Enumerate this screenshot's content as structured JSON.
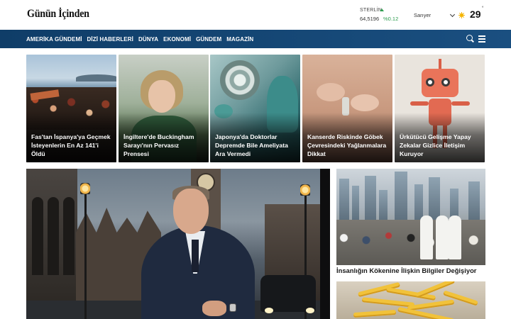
{
  "header": {
    "logo_text": "Günün İçinden",
    "currency": {
      "name": "STERLİN",
      "trend": "up",
      "value": "64,5196",
      "change": "%0.12",
      "trend_color": "#2e9e4f"
    },
    "weather": {
      "city": "Sarıyer",
      "temperature": "29",
      "unit": "°",
      "icon": "sun-icon"
    }
  },
  "nav": {
    "items": [
      "AMERİKA GÜNDEMİ",
      "DİZİ HABERLERİ",
      "DÜNYA",
      "EKONOMİ",
      "GÜNDEM",
      "MAGAZİN"
    ],
    "background": "#0f3d68",
    "icons": [
      "search-icon",
      "menu-icon"
    ]
  },
  "cards": [
    {
      "title": "Fas'tan İspanya'ya Geçmek İsteyenlerin En Az 141'i Öldü"
    },
    {
      "title": "İngiltere'de Buckingham Sarayı'nın Pervasız Prensesi"
    },
    {
      "title": "Japonya'da Doktorlar Depremde Bile Ameliyata Ara Vermedi"
    },
    {
      "title": "Kanserde Riskinde Göbek Çevresindeki Yağlanmalara Dikkat"
    },
    {
      "title": "Ürkütücü Gelişme Yapay Zekalar Gizlice İletişim Kuruyor"
    }
  ],
  "sidebar": {
    "stories": [
      {
        "title": "İnsanlığın Kökenine İlişkin Bilgiler Değişiyor"
      }
    ]
  }
}
